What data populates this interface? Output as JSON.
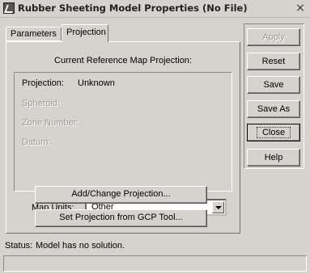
{
  "window": {
    "title": "Rubber Sheeting Model Properties (No File)",
    "close_glyph": "×"
  },
  "tabs": [
    {
      "label": "Parameters",
      "active": false
    },
    {
      "label": "Projection",
      "active": true
    }
  ],
  "projection_panel": {
    "heading": "Current Reference Map Projection:",
    "fields": [
      {
        "label": "Projection:",
        "value": "Unknown",
        "enabled": true
      },
      {
        "label": "Spheroid:",
        "value": "",
        "enabled": false
      },
      {
        "label": "Zone Number:",
        "value": "",
        "enabled": false
      },
      {
        "label": "Datum:",
        "value": "",
        "enabled": false
      }
    ],
    "map_units": {
      "label": "Map Units:",
      "selected": "Other"
    },
    "buttons": {
      "add_change": "Add/Change Projection...",
      "from_gcp": "Set Projection from GCP Tool..."
    }
  },
  "side_buttons": {
    "apply": "Apply",
    "reset": "Reset",
    "save": "Save",
    "save_as": "Save As",
    "close": "Close",
    "help": "Help"
  },
  "status": {
    "label": "Status:",
    "message": "Model has no solution."
  },
  "icons": {
    "app": "rubber-sheeting-app-icon",
    "dropdown": "chevron-down-icon"
  }
}
